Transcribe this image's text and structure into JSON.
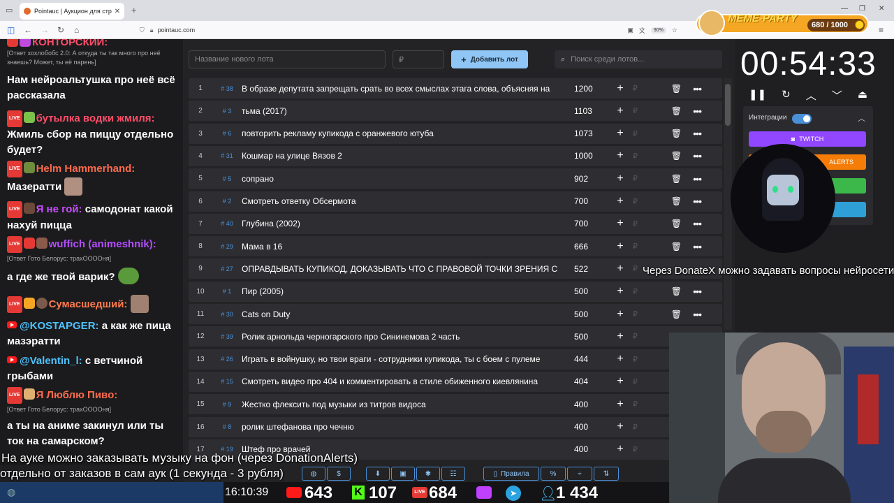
{
  "browser": {
    "tab_title": "Pointauc | Аукцион для стрим",
    "url": "pointauc.com",
    "zoom": "90%"
  },
  "chat": {
    "top_partial": "КОНТОРСКИЙ:",
    "messages": [
      {
        "reply": "[Ответ хохлобобс 2.0: А откуда ты так много про неё знаешь? Может, ты её парень]",
        "user": "",
        "text": "Нам нейроальтушка про неё всё рассказала"
      },
      {
        "user": "бутылка водки жмиля:",
        "user_color": "#ff4d6a",
        "text": "Жмиль сбор на пиццу отдельно будет?"
      },
      {
        "user": "Helm Hammerhand:",
        "user_color": "#ff6b4d",
        "text": "Мазератти"
      },
      {
        "user": "Я не гой:",
        "user_color": "#c84dff",
        "text": "самодонат какой нахуй пицца"
      },
      {
        "user": "wuffich (animeshnik):",
        "user_color": "#b44dff",
        "reply": "[Ответ Гото Белорус: трахОООOня]",
        "text": "а где же твой варик?"
      },
      {
        "user": "Сумасшедший:",
        "user_color": "#ff7a4d",
        "text": ""
      },
      {
        "user": "@KOSTAPGER:",
        "user_color": "#4dc3ff",
        "text": "а как же пица мазэратти"
      },
      {
        "user": "@Valentin_l:",
        "user_color": "#4dc3ff",
        "text": "с ветчиной грыбами"
      },
      {
        "user": "Я Люблю Пиво:",
        "user_color": "#ff6b4d",
        "reply": "[Ответ Гото Белорус: трахОООOня]",
        "text": "а ты на аниме закинул или ты ток на самарском?"
      }
    ]
  },
  "lots": {
    "name_placeholder": "Название нового лота",
    "amount_placeholder": "₽",
    "add_label": "Добавить лот",
    "search_placeholder": "Поиск среди лотов...",
    "rows": [
      {
        "n": "1",
        "id": "# 38",
        "name": "В образе депутата запрещать срать во всех смыслах этага слова, объясняя на",
        "amount": "1200",
        "trash": true
      },
      {
        "n": "2",
        "id": "# 3",
        "name": "тьма (2017)",
        "amount": "1103",
        "trash": true
      },
      {
        "n": "3",
        "id": "# 6",
        "name": "повторить рекламу купикода с оранжевого ютуба",
        "amount": "1073",
        "trash": true
      },
      {
        "n": "4",
        "id": "# 31",
        "name": "Кошмар на улице Вязов 2",
        "amount": "1000",
        "trash": true
      },
      {
        "n": "5",
        "id": "# 5",
        "name": "сопрано",
        "amount": "902",
        "trash": true
      },
      {
        "n": "6",
        "id": "# 2",
        "name": "Смотреть ответку Обсермота",
        "amount": "700",
        "trash": true
      },
      {
        "n": "7",
        "id": "# 40",
        "name": "Глубина (2002)",
        "amount": "700",
        "trash": true
      },
      {
        "n": "8",
        "id": "# 29",
        "name": "Мама в 16",
        "amount": "666",
        "trash": true
      },
      {
        "n": "9",
        "id": "# 27",
        "name": "ОПРАВДЫВАТЬ КУПИКОД, ДОКАЗЫВАТЬ ЧТО С ПРАВОВОЙ ТОЧКИ ЗРЕНИЯ С",
        "amount": "522",
        "trash": false
      },
      {
        "n": "10",
        "id": "# 1",
        "name": "Пир (2005)",
        "amount": "500",
        "trash": true
      },
      {
        "n": "11",
        "id": "# 30",
        "name": "Cats on Duty",
        "amount": "500",
        "trash": true
      },
      {
        "n": "12",
        "id": "# 39",
        "name": "Ролик арнольда черногарского про Сининемова 2 часть",
        "amount": "500",
        "trash": false
      },
      {
        "n": "13",
        "id": "# 26",
        "name": "Играть в войнушку, но твои враги - сотрудники купикода, ты с боем с пулеме",
        "amount": "444",
        "trash": false
      },
      {
        "n": "14",
        "id": "# 15",
        "name": "Смотреть видео про 404 и комментировать в стиле обиженного киевлянина",
        "amount": "404",
        "trash": false
      },
      {
        "n": "15",
        "id": "# 9",
        "name": "Жестко флексить под музыки из титров видоса",
        "amount": "400",
        "trash": false
      },
      {
        "n": "16",
        "id": "# 8",
        "name": " ролик штефанова про чечню",
        "amount": "400",
        "trash": false
      },
      {
        "n": "17",
        "id": "# 19",
        "name": "Штеф про врачей",
        "amount": "400",
        "trash": false
      }
    ]
  },
  "timer": {
    "value": "00:54:33"
  },
  "integrations": {
    "label": "Интеграции",
    "twitch": "TWITCH",
    "alerts": "ALERTS"
  },
  "meme": {
    "title": "MEME-PARTY",
    "score": "680 / 1000"
  },
  "toolbar": {
    "rules": "Правила",
    "percent": "%"
  },
  "overlay": {
    "donatex": "Через DonateX можно задавать вопросы нейросети",
    "music_line1": "На ауке можно заказывать музыку на фон (через DonationAlerts)",
    "music_line2": "отдельно от заказов в сам аук (1 секунда - 3 рубля)"
  },
  "stats": {
    "clock": "16:10:39",
    "youtube": "643",
    "kick": "107",
    "live": "684",
    "total": "1 434"
  },
  "colors": {
    "accent": "#90c6f5",
    "twitch": "#9147ff",
    "alerts": "#f57d07",
    "green": "#3cb84a",
    "blue": "#2f9fd8"
  }
}
